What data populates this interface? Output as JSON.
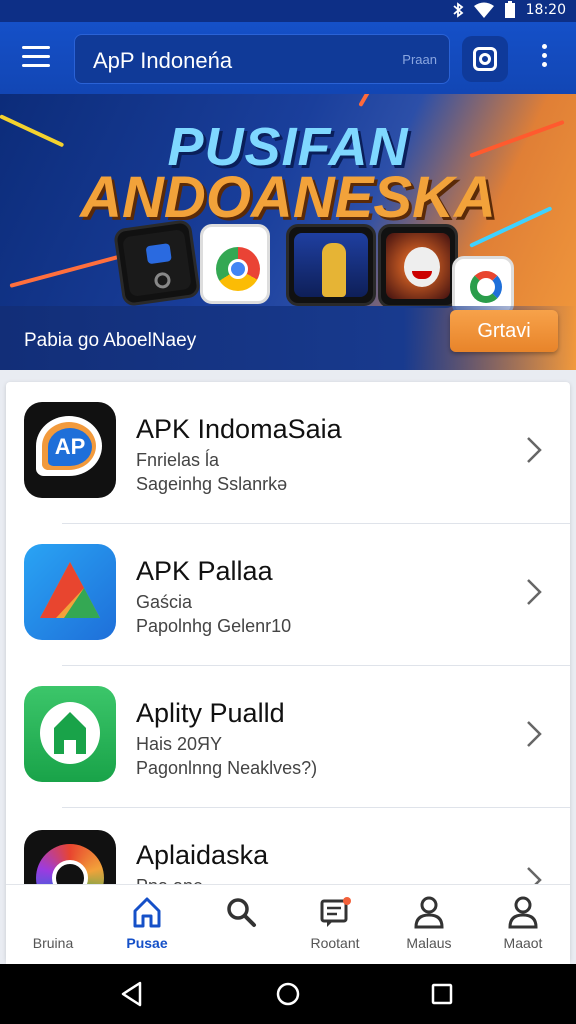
{
  "status_bar": {
    "time": "18:20"
  },
  "app_bar": {
    "search_value": "ApP Indoneńa",
    "search_hint": "Praan"
  },
  "banner": {
    "title_line1": "PUSIFAN",
    "title_line2": "ANDOANESKA",
    "caption": "Pabia go AboelNaey",
    "cta": "Grtavi"
  },
  "apps": [
    {
      "name": "APK IndomaSaia",
      "line1": "Fnrielas ĺa",
      "line2": "Sageinhg Sslanrkǝ",
      "icon": "ap-logo-icon"
    },
    {
      "name": "APK Pallaa",
      "line1": "Gaścia",
      "line2": "Papolnhg Gelenr10",
      "icon": "triangle-logo-icon"
    },
    {
      "name": "Aplity Pualld",
      "line1": "Hais 20ЯY",
      "line2": "Pagonlnng  Neaklves?)",
      "icon": "shield-logo-icon"
    },
    {
      "name": "Aplaidaska",
      "line1": "Pna  ane",
      "line2": "",
      "icon": "ring-logo-icon"
    }
  ],
  "bottom_nav": [
    {
      "label": "Bruina",
      "icon": "none"
    },
    {
      "label": "Pusae",
      "icon": "home-icon"
    },
    {
      "label": "",
      "icon": "search-icon"
    },
    {
      "label": "Rootant",
      "icon": "message-icon"
    },
    {
      "label": "Malaus",
      "icon": "user-icon"
    },
    {
      "label": "Maaot",
      "icon": "user-icon"
    }
  ],
  "colors": {
    "primary": "#1550c8",
    "accent": "#f29a3c"
  }
}
